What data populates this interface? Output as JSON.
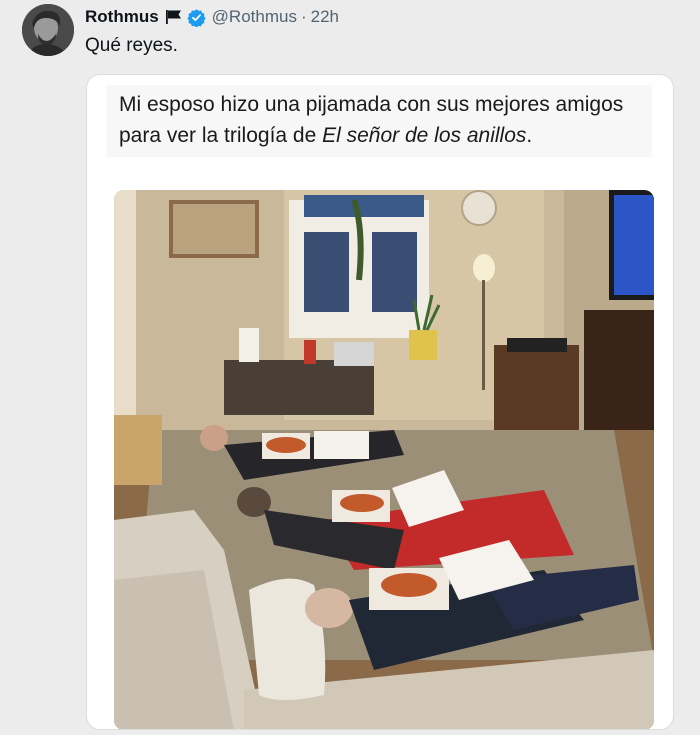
{
  "tweet": {
    "display_name": "Rothmus",
    "handle": "@Rothmus",
    "separator": "·",
    "time": "22h",
    "text": "Qué reyes.",
    "icons": {
      "avatar": "avatar-photo",
      "flag": "flag-icon",
      "verified": "verified-badge-icon"
    },
    "colors": {
      "verified": "#1d9bf0",
      "secondary_text": "#536471"
    }
  },
  "quote": {
    "text_part1": "Mi esposo hizo una pijamada con sus mejores amigos para ver la trilogía de ",
    "text_italic": "El señor de los anillos",
    "text_part2": "."
  }
}
